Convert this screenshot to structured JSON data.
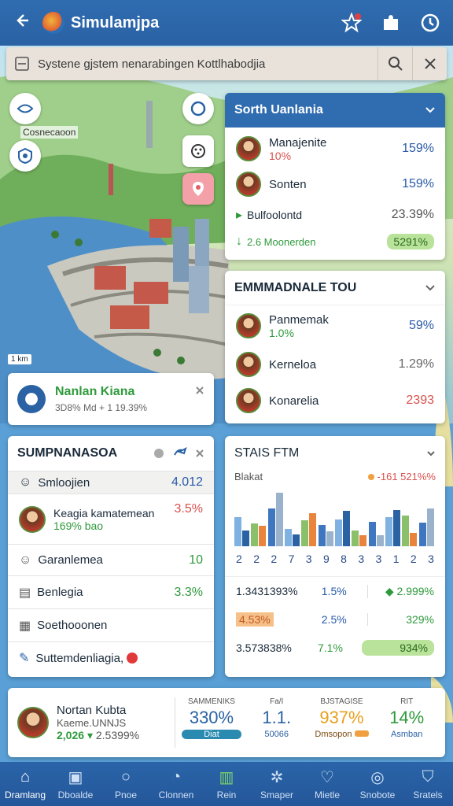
{
  "app": {
    "title": "Simulamjpa"
  },
  "search": {
    "text": "Systene gjstem nenarabingen Kottlhabodjia"
  },
  "map": {
    "label_left": "Cosnecaoon",
    "scale_label": "1 km"
  },
  "panel_sorth": {
    "title": "Sorth Uanlania",
    "rows": [
      {
        "name": "Manajenite",
        "sub": "10%",
        "value": "159%"
      },
      {
        "name": "Sonten",
        "sub": "",
        "value": "159%"
      },
      {
        "name": "Bulfoolontd",
        "sub": "",
        "value": "23.39%"
      },
      {
        "name": "2.6 Moonerden",
        "sub": "",
        "value": "5291%"
      }
    ]
  },
  "panel_emm": {
    "title": "EMMMADNALE TOU",
    "rows": [
      {
        "name": "Panmemak",
        "sub": "1.0%",
        "value": "59%"
      },
      {
        "name": "Kerneloa",
        "value": "1.29%"
      },
      {
        "name": "Konarelia",
        "value": "2393"
      }
    ]
  },
  "notice": {
    "title": "Nanlan Kiana",
    "sub": "3D8% Md + 1 19.39%"
  },
  "panel_sump": {
    "title": "SUMPNANASOA",
    "rows": [
      {
        "name": "Smloojien",
        "value": "4.012"
      },
      {
        "name": "Keagia kamatemean",
        "sub": "169% bao",
        "value": "3.5%"
      },
      {
        "name": "Garanlemea",
        "value": "10"
      },
      {
        "name": "Benlegia",
        "value": "3.3%"
      },
      {
        "name": "Soethooonen",
        "value": ""
      },
      {
        "name": "Suttemdenliagia,",
        "value": ""
      }
    ]
  },
  "panel_stats": {
    "title": "STAIS FTM",
    "legend_left": "Blakat",
    "legend_right": "-161 521%%",
    "x_labels": [
      "2",
      "2",
      "2",
      "7",
      "3",
      "9",
      "8",
      "3",
      "3",
      "1",
      "2",
      "3"
    ],
    "chart_data": {
      "type": "bar",
      "categories": [
        "2",
        "2",
        "2",
        "7",
        "3",
        "9",
        "8",
        "3",
        "3",
        "1",
        "2",
        "3"
      ],
      "series": [
        {
          "values": [
            55,
            42,
            70,
            32,
            48,
            40,
            50,
            30,
            45,
            55,
            58,
            44
          ]
        },
        {
          "values": [
            30,
            38,
            100,
            22,
            62,
            28,
            66,
            20,
            20,
            68,
            25,
            70
          ]
        }
      ],
      "ylim": [
        0,
        100
      ]
    },
    "rows": [
      [
        "1.3431393%",
        "1.5%",
        "2.999%"
      ],
      [
        "4.53%",
        "2.5%",
        "329%"
      ],
      [
        "3.573838%",
        "7.1%",
        "934%"
      ]
    ]
  },
  "summary": {
    "name": "Nortan Kubta",
    "sub": "Kaeme.UNNJS",
    "v1": "2,026",
    "v2": "2.5399%",
    "cols": [
      {
        "label": "SAMMENIKS",
        "value": "330%",
        "sub": "Diat"
      },
      {
        "label": "Fa/I",
        "value": "1.1.",
        "sub": "50066"
      },
      {
        "label": "BJSTAGISE",
        "value": "937%",
        "sub": "Dmsopon"
      },
      {
        "label": "RIT",
        "value": "14%",
        "sub": "Asmban"
      }
    ]
  },
  "nav": [
    {
      "label": "Dramlang",
      "icon": "home-icon"
    },
    {
      "label": "Dboalde",
      "icon": "map-icon"
    },
    {
      "label": "Pnoe",
      "icon": "search-icon"
    },
    {
      "label": "Clonnen",
      "icon": "compass-icon"
    },
    {
      "label": "Rein",
      "icon": "chart-icon"
    },
    {
      "label": "Smaper",
      "icon": "gear-icon"
    },
    {
      "label": "Mietle",
      "icon": "heart-icon"
    },
    {
      "label": "Snobote",
      "icon": "globe-icon"
    },
    {
      "label": "Sratels",
      "icon": "shield-icon"
    }
  ],
  "colors": {
    "primary": "#2a62a4",
    "accent_green": "#2f9a3c",
    "accent_red": "#d8504c"
  }
}
